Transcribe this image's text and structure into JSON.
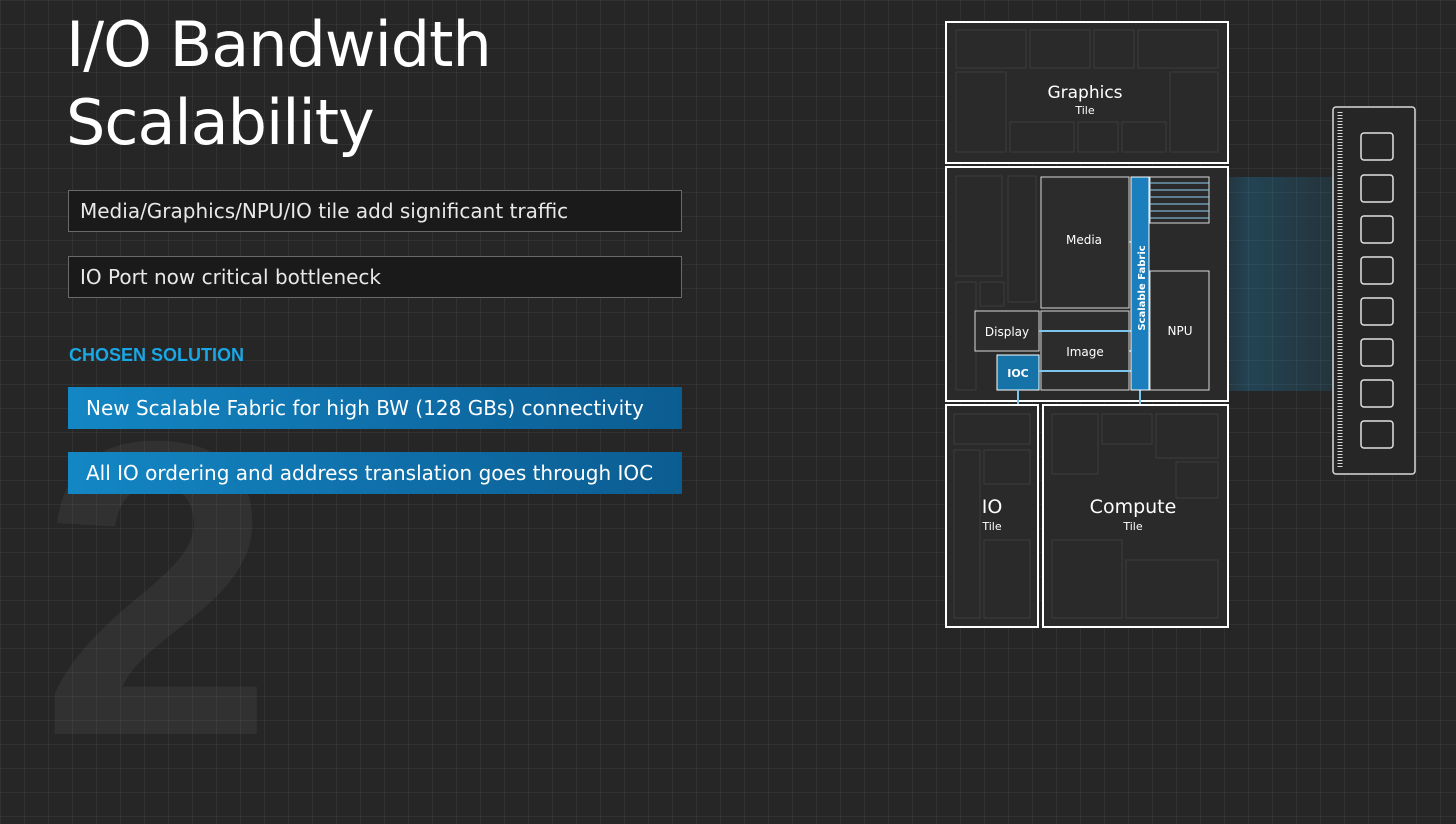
{
  "slide": {
    "title_line1": "I/O Bandwidth",
    "title_line2": "Scalability",
    "background_number": "2"
  },
  "problems": [
    "Media/Graphics/NPU/IO tile add significant traffic",
    "IO Port now critical bottleneck"
  ],
  "solution_label": "CHOSEN SOLUTION",
  "solutions": [
    "New Scalable Fabric for high BW (128 GBs) connectivity",
    "All IO ordering and address translation goes through IOC"
  ],
  "diagram": {
    "graphics_tile": {
      "name": "Graphics",
      "sub": "Tile"
    },
    "io_tile": {
      "name": "IO",
      "sub": "Tile"
    },
    "compute_tile": {
      "name": "Compute",
      "sub": "Tile"
    },
    "blocks": {
      "media": "Media",
      "display": "Display",
      "image": "Image",
      "ioc": "IOC",
      "npu": "NPU",
      "fabric": "Scalable Fabric"
    }
  },
  "colors": {
    "accent": "#19a7e6",
    "solution_bar": "#1387c4",
    "fabric": "#1b7fbe",
    "background": "#262626"
  }
}
